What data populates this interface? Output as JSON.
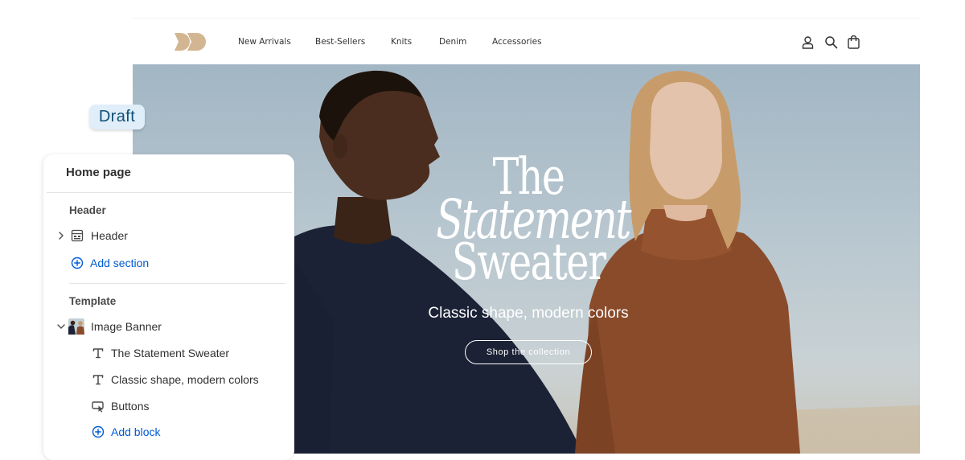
{
  "storefront": {
    "nav": {
      "links": [
        "New Arrivals",
        "Best-Sellers",
        "Knits",
        "Denim",
        "Accessories"
      ],
      "icons": [
        "account-icon",
        "search-icon",
        "cart-icon"
      ]
    },
    "hero": {
      "title_line1": "The",
      "title_line2": "Statement",
      "title_line3": "Sweater",
      "subtitle": "Classic shape, modern colors",
      "button_label": "Shop the collection"
    }
  },
  "editor": {
    "status_badge": "Draft",
    "panel": {
      "title": "Home page",
      "header_group": {
        "label": "Header",
        "section_label": "Header",
        "add_section": "Add section"
      },
      "template_group": {
        "label": "Template",
        "section_label": "Image Banner",
        "blocks": [
          "The Statement Sweater",
          "Classic shape, modern colors",
          "Buttons"
        ],
        "add_block": "Add block"
      }
    }
  },
  "colors": {
    "link": "#005bd3",
    "badge_bg": "#dfeef9",
    "badge_text": "#114f76",
    "logo": "#d2b692"
  }
}
